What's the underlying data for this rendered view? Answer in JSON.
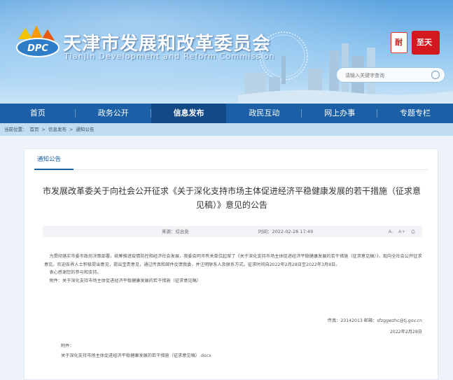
{
  "header": {
    "site_title": "天津市发展和改革委员会",
    "site_subtitle": "Tianjin Development and Reform Commission",
    "logo_text": "DPC",
    "emblem_left_text": "耐",
    "emblem_right_text": "至天"
  },
  "search": {
    "placeholder": "请输入关键字查询"
  },
  "nav": {
    "items": [
      {
        "label": "首页"
      },
      {
        "label": "政务公开"
      },
      {
        "label": "信息发布"
      },
      {
        "label": "政民互动"
      },
      {
        "label": "网上办事"
      },
      {
        "label": "专题专栏"
      }
    ]
  },
  "breadcrumb": {
    "prefix": "当前位置：",
    "items": [
      "首页",
      ">",
      "信息发布",
      ">",
      "通知公告"
    ]
  },
  "tab": {
    "label": "通知公告"
  },
  "article": {
    "title": "市发展改革委关于向社会公开征求《关于深化支持市场主体促进经济平稳健康发展的若干措施（征求意见稿）》意见的公告",
    "source": "来源：综合处",
    "time": "时间：2022-02-28 17:49",
    "tools": [
      "A-",
      "A+",
      "⎙"
    ],
    "paragraph1": "为贯彻落实市委市政府决策部署，统筹推进疫情防控和经济社会发展，我委会同市有关单位起草了《关于深化支持市场主体促进经济平稳健康发展的若干措施（征求意见稿）》，现向全社会公开征求意见。欢迎各界人士积极提出意见，提出宝贵意见，通过传真和邮件反馈我委，并注明联系人及联系方式。征求时间自2022年2月28日至2022年3月8日。",
    "paragraph2": "衷心感谢您的参与和支持。",
    "paragraph3": "附件：关于深化支持市场主体促进经济平稳健康发展的若干措施（征求意见稿）",
    "contact": "传真：23142013   邮箱：sfzggwzhc@tj.gov.cn",
    "date": "2022年2月28日",
    "attach_label": "附件：",
    "attach_file": "关于深化支持市场主体促进经济平稳健康发展的若干措施（征求意见稿）.docx"
  },
  "colors": {
    "nav_bg": "#1b5fa6",
    "nav_active": "#124a88",
    "breadcrumb_bg": "#bfdcf3",
    "accent": "#1b5fa6"
  }
}
